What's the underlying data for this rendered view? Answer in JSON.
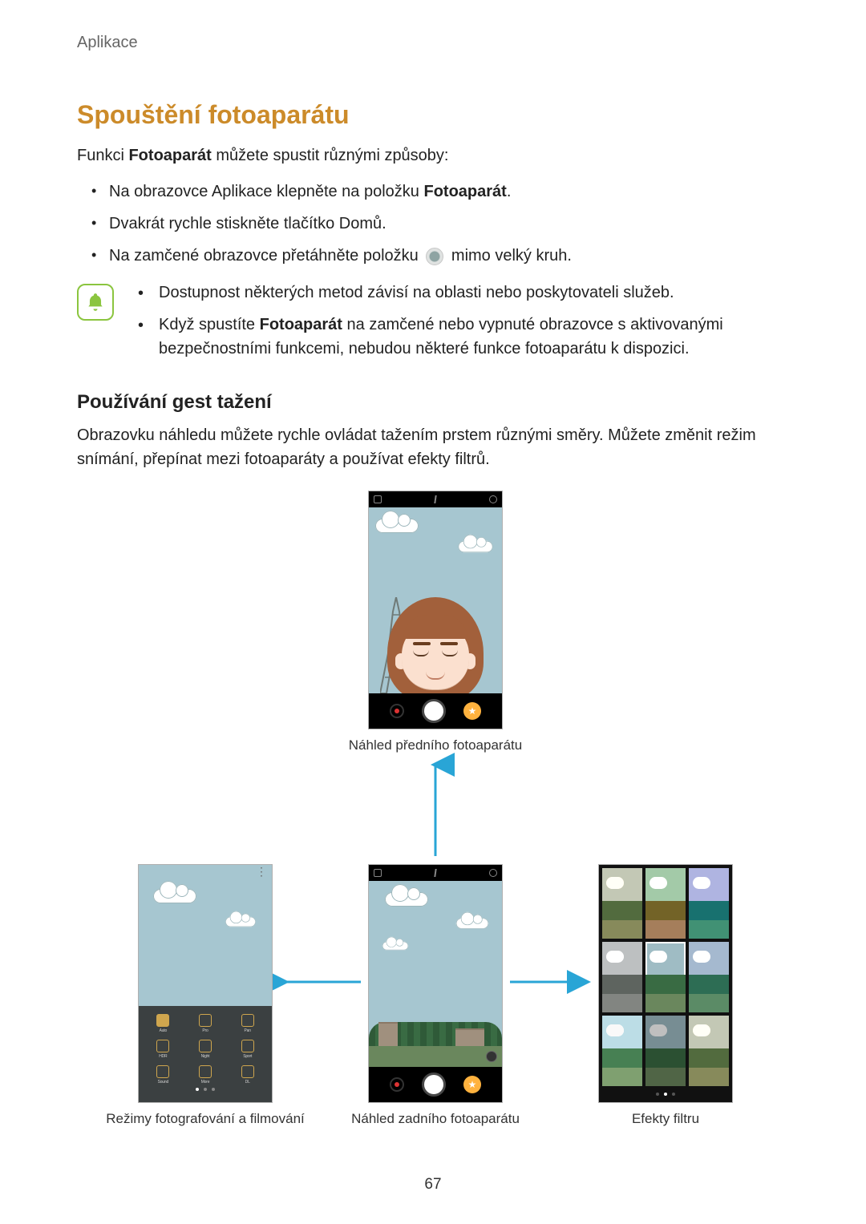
{
  "header": {
    "section": "Aplikace"
  },
  "title": "Spouštění fotoaparátu",
  "intro": {
    "pre": "Funkci ",
    "bold": "Fotoaparát",
    "post": " můžete spustit různými způsoby:"
  },
  "bullets": [
    {
      "pre": "Na obrazovce Aplikace klepněte na položku ",
      "bold": "Fotoaparát",
      "post": "."
    },
    {
      "pre": "Dvakrát rychle stiskněte tlačítko Domů.",
      "bold": "",
      "post": ""
    },
    {
      "pre": "Na zamčené obrazovce přetáhněte položku ",
      "post_icon": "camera-drag-icon",
      "post": " mimo velký kruh."
    }
  ],
  "notes": [
    {
      "text": "Dostupnost některých metod závisí na oblasti nebo poskytovateli služeb."
    },
    {
      "pre": "Když spustíte ",
      "bold": "Fotoaparát",
      "post": " na zamčené nebo vypnuté obrazovce s aktivovanými bezpečnostními funkcemi, nebudou některé funkce fotoaparátu k dispozici."
    }
  ],
  "subheading": "Používání gest tažení",
  "paragraph": "Obrazovku náhledu můžete rychle ovládat tažením prstem různými směry. Můžete změnit režim snímání, přepínat mezi fotoaparáty a používat efekty filtrů.",
  "captions": {
    "front": "Náhled předního fotoaparátu",
    "modes": "Režimy fotografování a filmování",
    "rear": "Náhled zadního fotoaparátu",
    "filters": "Efekty filtru"
  },
  "page_number": "67"
}
